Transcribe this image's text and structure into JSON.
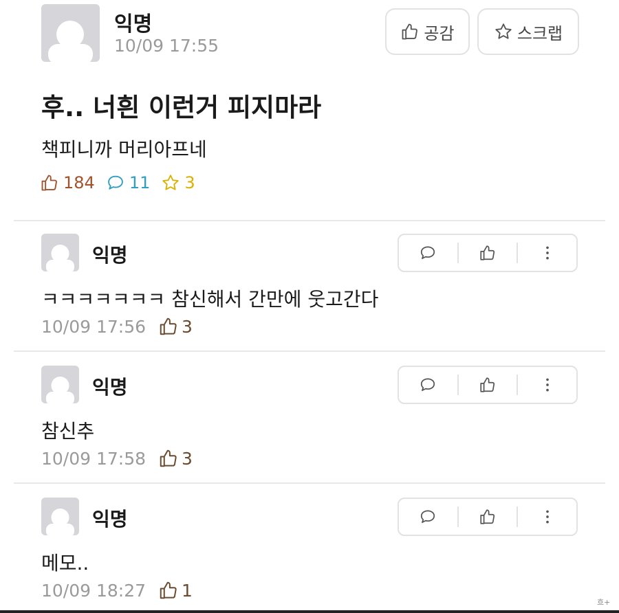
{
  "post": {
    "author": "익명",
    "time": "10/09 17:55",
    "like_button": "공감",
    "scrap_button": "스크랩",
    "title": "후.. 너흰 이런거 피지마라",
    "body": "책피니까 머리아프네",
    "stats": {
      "likes": "184",
      "comments": "11",
      "scraps": "3"
    }
  },
  "comments": [
    {
      "author": "익명",
      "body": "ㅋㅋㅋㅋㅋㅋㅋ 참신해서 간만에 웃고간다",
      "time": "10/09 17:56",
      "likes": "3"
    },
    {
      "author": "익명",
      "body": "참신추",
      "time": "10/09 17:58",
      "likes": "3"
    },
    {
      "author": "익명",
      "body": "메모..",
      "time": "10/09 18:27",
      "likes": "1"
    }
  ],
  "icons": {
    "like": "thumbs-up-icon",
    "comment": "speech-bubble-icon",
    "scrap": "star-icon",
    "more": "more-vertical-icon"
  },
  "colors": {
    "like_stat": "#a0522d",
    "comment_stat": "#2f9fbf",
    "scrap_stat": "#d9b200",
    "comment_like": "#6b4a2e"
  },
  "watermark": "흐+"
}
